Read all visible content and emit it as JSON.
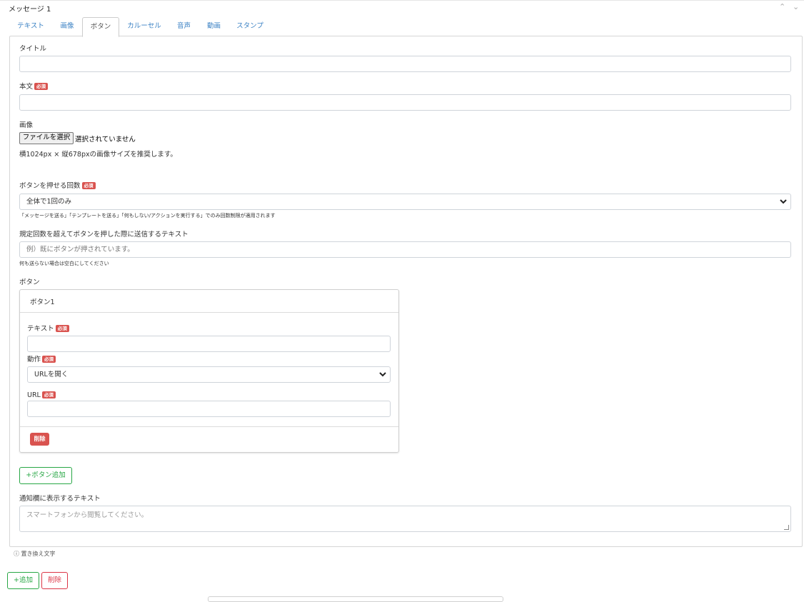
{
  "header": {
    "title": "メッセージ 1",
    "collapse_up": "⌃",
    "collapse_down": "⌄"
  },
  "tabs": [
    {
      "label": "テキスト"
    },
    {
      "label": "画像"
    },
    {
      "label": "ボタン"
    },
    {
      "label": "カルーセル"
    },
    {
      "label": "音声"
    },
    {
      "label": "動画"
    },
    {
      "label": "スタンプ"
    }
  ],
  "form": {
    "required_badge": "必須",
    "title_label": "タイトル",
    "title_value": "",
    "body_label": "本文",
    "body_value": "",
    "image_label": "画像",
    "file_button": "ファイルを選択",
    "file_status": "選択されていません",
    "image_hint": "横1024px × 縦678pxの画像サイズを推奨します。",
    "press_count_label": "ボタンを押せる回数",
    "press_count_value": "全体で1回のみ",
    "press_count_note": "「メッセージを送る」「テンプレートを送る」「何もしない/アクションを実行する」でのみ回数制限が適用されます",
    "over_limit_label": "規定回数を超えてボタンを押した際に送信するテキスト",
    "over_limit_placeholder": "例）既にボタンが押されています。",
    "over_limit_note": "何も送らない場合は空白にしてください",
    "buttons_label": "ボタン",
    "add_button": "+ボタン追加",
    "notification_label": "通知欄に表示するテキスト",
    "notification_placeholder": "スマートフォンから閲覧してください。"
  },
  "button_card": {
    "title": "ボタン1",
    "text_label": "テキスト",
    "text_value": "",
    "action_label": "動作",
    "action_value": "URLを開く",
    "url_label": "URL",
    "url_value": "",
    "delete": "削除"
  },
  "footer": {
    "replace_text": "ⓘ 置き換え文字",
    "add": "+追加",
    "delete": "削除"
  }
}
